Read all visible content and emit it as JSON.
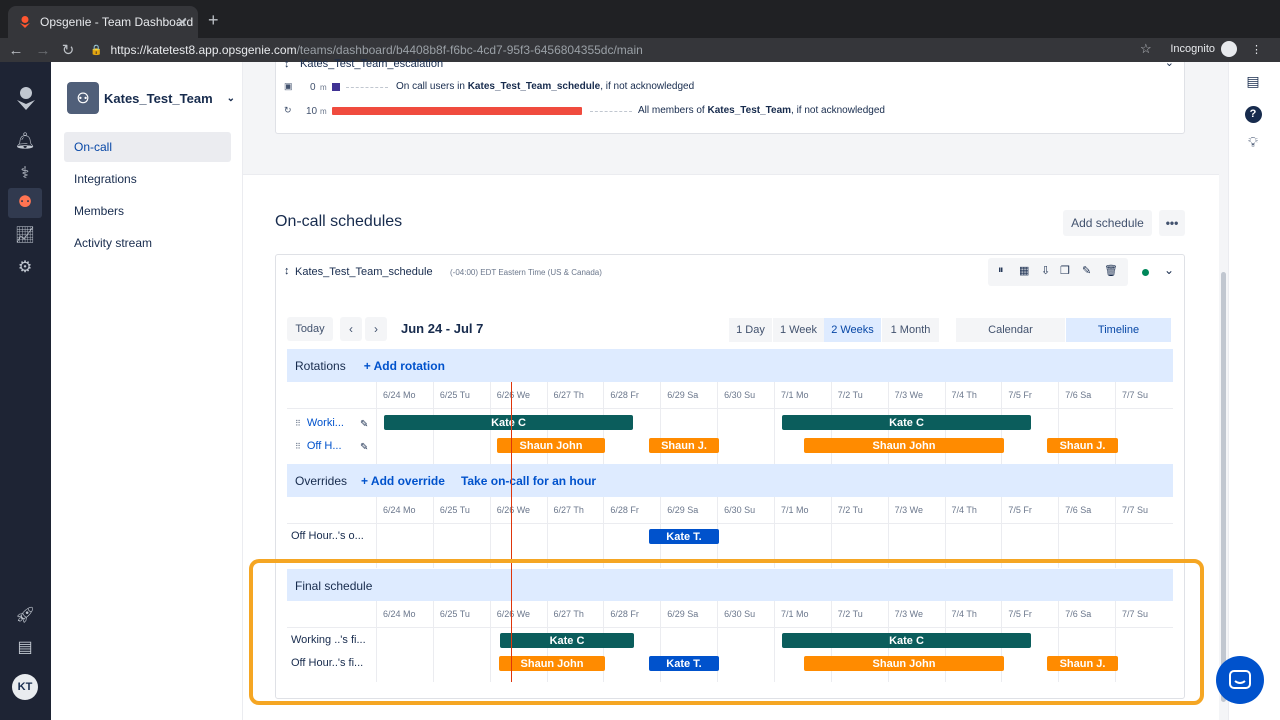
{
  "browser": {
    "tab_title": "Opsgenie - Team Dashboard",
    "url_host": "https://katetest8.app.opsgenie.com",
    "url_path": "/teams/dashboard/b4408b8f-f6bc-4cd7-95f3-6456804355dc/main",
    "profile": "Incognito"
  },
  "sidebar": {
    "team_name": "Kates_Test_Team",
    "items": [
      {
        "label": "On-call"
      },
      {
        "label": "Integrations"
      },
      {
        "label": "Members"
      },
      {
        "label": "Activity stream"
      }
    ],
    "avatar_initials": "KT"
  },
  "escalation": {
    "name": "Kates_Test_Team_escalation",
    "rules": [
      {
        "delay": "0",
        "unit": "m",
        "text_pre": "On call users in ",
        "target": "Kates_Test_Team_schedule",
        "text_post": ", if not acknowledged"
      },
      {
        "delay": "10",
        "unit": "m",
        "text_pre": "All members of ",
        "target": "Kates_Test_Team",
        "text_post": ", if not acknowledged"
      }
    ]
  },
  "schedules": {
    "title": "On-call schedules",
    "add_label": "Add schedule",
    "schedule_name": "Kates_Test_Team_schedule",
    "timezone": "(-04:00) EDT Eastern Time (US & Canada)",
    "today_label": "Today",
    "date_range": "Jun 24 - Jul 7",
    "ranges": [
      "1 Day",
      "1 Week",
      "2 Weeks",
      "1 Month"
    ],
    "views": [
      "Calendar",
      "Timeline"
    ],
    "days": [
      "6/24 Mo",
      "6/25 Tu",
      "6/26 We",
      "6/27 Th",
      "6/28 Fr",
      "6/29 Sa",
      "6/30 Su",
      "7/1 Mo",
      "7/2 Tu",
      "7/3 We",
      "7/4 Th",
      "7/5 Fr",
      "7/6 Sa",
      "7/7 Su"
    ],
    "rotations": {
      "title": "Rotations",
      "add_label": "+ Add rotation",
      "rows": [
        {
          "label": "Worki...",
          "bars": [
            {
              "text": "Kate C"
            },
            {
              "text": "Kate C"
            }
          ]
        },
        {
          "label": "Off H...",
          "bars": [
            {
              "text": "Shaun John"
            },
            {
              "text": "Shaun J."
            },
            {
              "text": "Shaun John"
            },
            {
              "text": "Shaun J."
            }
          ]
        }
      ]
    },
    "overrides": {
      "title": "Overrides",
      "add_label": "+ Add override",
      "take_label": "Take on-call for an hour",
      "rows": [
        {
          "label": "Off Hour..'s o...",
          "bars": [
            {
              "text": "Kate T."
            }
          ]
        }
      ]
    },
    "final": {
      "title": "Final schedule",
      "rows": [
        {
          "label": "Working ..'s fi...",
          "bars": [
            {
              "text": "Kate C"
            },
            {
              "text": "Kate C"
            }
          ]
        },
        {
          "label": "Off Hour..'s fi...",
          "bars": [
            {
              "text": "Shaun John"
            },
            {
              "text": "Kate T."
            },
            {
              "text": "Shaun John"
            },
            {
              "text": "Shaun J."
            }
          ]
        }
      ]
    }
  },
  "colors": {
    "teal": "#0b5d5c",
    "orange": "#ff8b00",
    "blue": "#0052cc",
    "highlight": "#f5a623",
    "now_line": "#de350b"
  }
}
